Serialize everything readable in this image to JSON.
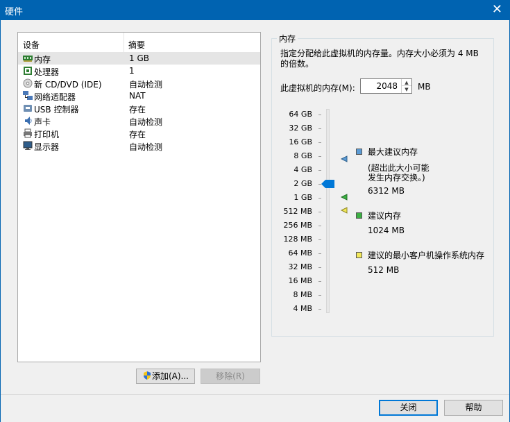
{
  "window": {
    "title": "硬件",
    "close_glyph": "✕"
  },
  "device_list": {
    "columns": [
      "设备",
      "摘要"
    ],
    "items": [
      {
        "name": "内存",
        "summary": "1 GB",
        "icon": "memory-icon",
        "selected": true
      },
      {
        "name": "处理器",
        "summary": "1",
        "icon": "processor-icon"
      },
      {
        "name": "新 CD/DVD (IDE)",
        "summary": "自动检测",
        "icon": "cd-dvd-icon"
      },
      {
        "name": "网络适配器",
        "summary": "NAT",
        "icon": "network-adapter-icon"
      },
      {
        "name": "USB 控制器",
        "summary": "存在",
        "icon": "usb-icon"
      },
      {
        "name": "声卡",
        "summary": "自动检测",
        "icon": "sound-card-icon"
      },
      {
        "name": "打印机",
        "summary": "存在",
        "icon": "printer-icon"
      },
      {
        "name": "显示器",
        "summary": "自动检测",
        "icon": "display-icon"
      }
    ]
  },
  "buttons": {
    "add": "添加(A)...",
    "remove": "移除(R)",
    "close": "关闭",
    "help": "帮助"
  },
  "memory": {
    "group_title": "内存",
    "description": "指定分配给此虚拟机的内存量。内存大小必须为 4 MB 的倍数。",
    "field_label": "此虚拟机的内存(M):",
    "value": "2048",
    "unit": "MB",
    "scale_labels": [
      "64 GB",
      "32 GB",
      "16 GB",
      "8 GB",
      "4 GB",
      "2 GB",
      "1 GB",
      "512 MB",
      "256 MB",
      "128 MB",
      "64 MB",
      "32 MB",
      "16 MB",
      "8 MB",
      "4 MB"
    ],
    "legend": {
      "max": {
        "title": "最大建议内存",
        "note1": "(超出此大小可能",
        "note2": "发生内存交换。)",
        "value": "6312 MB",
        "color": "#5b9bd5"
      },
      "recommended": {
        "title": "建议内存",
        "value": "1024 MB",
        "color": "#3cb043"
      },
      "min": {
        "title": "建议的最小客户机操作系统内存",
        "value": "512 MB",
        "color": "#f2e85a"
      }
    }
  }
}
